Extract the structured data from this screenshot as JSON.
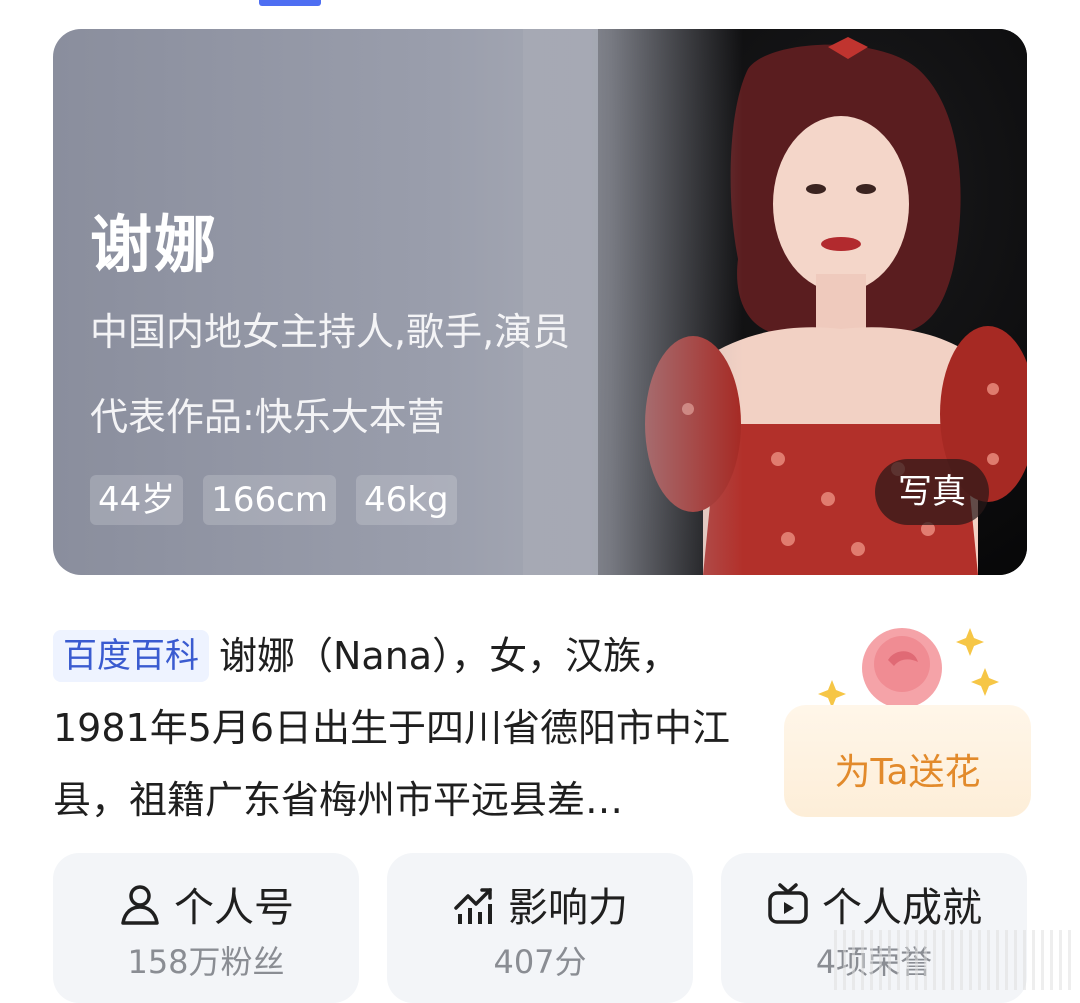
{
  "hero": {
    "name": "谢娜",
    "description": "中国内地女主持人,歌手,演员",
    "works": "代表作品:快乐大本营",
    "tags": [
      "44岁",
      "166cm",
      "46kg"
    ],
    "photo_button": "写真"
  },
  "intro": {
    "badge": "百度百科",
    "text": "谢娜（Nana），女，汉族，1981年5月6日出生于四川省德阳市中江县，祖籍广东省梅州市平远县差…"
  },
  "flower": {
    "label": "为Ta送花"
  },
  "stats": [
    {
      "title": "个人号",
      "sub": "158万粉丝",
      "icon": "person-icon"
    },
    {
      "title": "影响力",
      "sub": "407分",
      "icon": "trend-chart-icon"
    },
    {
      "title": "个人成就",
      "sub": "4项荣誉",
      "icon": "tv-icon"
    }
  ],
  "colors": {
    "accent": "#4e6ef2",
    "badge_text": "#3a5bd0",
    "flower_text": "#e28a2b"
  }
}
